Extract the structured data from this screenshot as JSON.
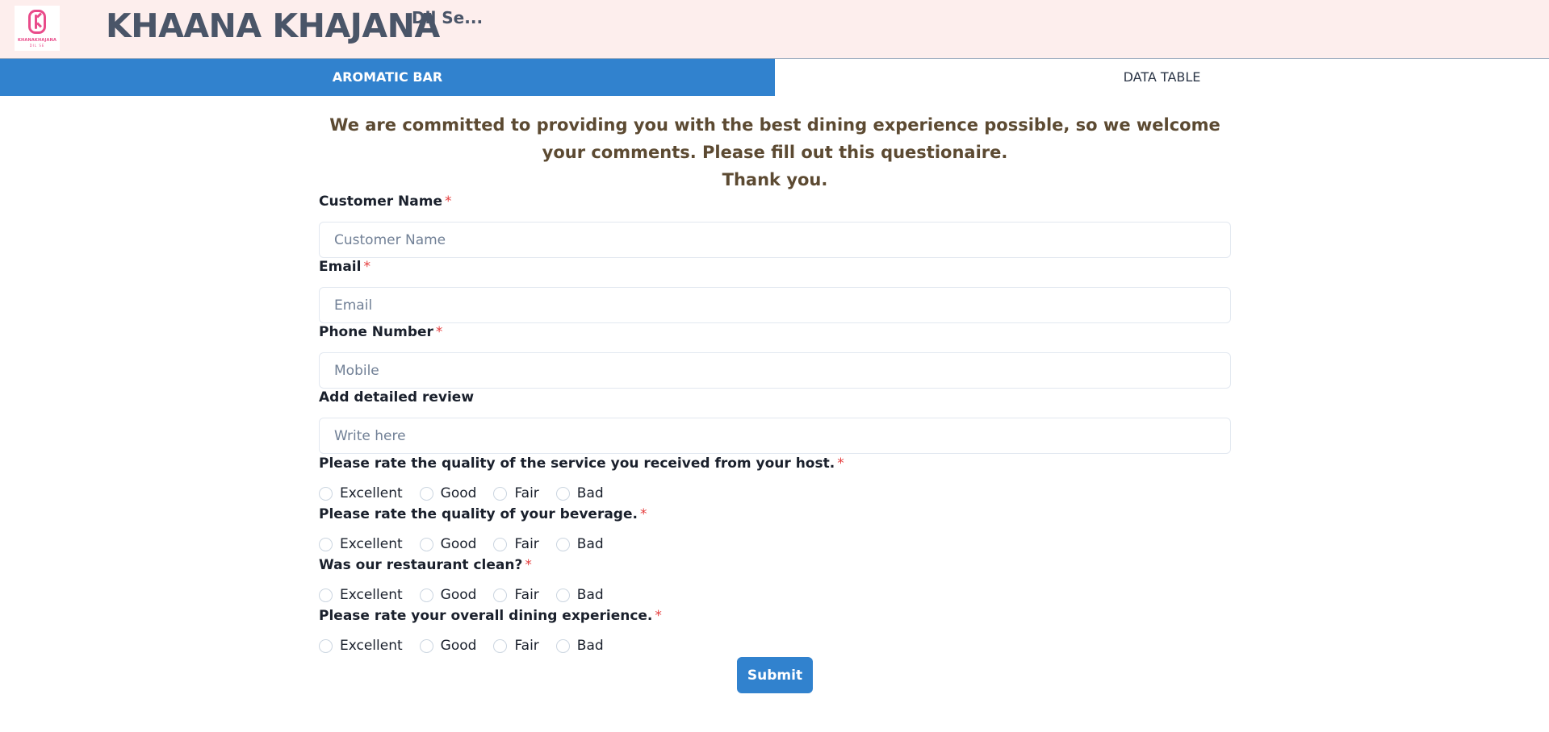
{
  "header": {
    "logo_text": "KHANAKHAJANA",
    "logo_subtext": "DIL SE",
    "brand": "KHAANA KHAJANA",
    "tagline": "Dil Se..."
  },
  "tabs": [
    {
      "label": "AROMATIC BAR",
      "active": true
    },
    {
      "label": "DATA TABLE",
      "active": false
    }
  ],
  "intro": {
    "line1": "We are committed to providing you with the best dining experience possible, so we welcome your comments. Please fill out this questionaire.",
    "line2": "Thank you."
  },
  "form": {
    "required_mark": "*",
    "fields": [
      {
        "label": "Customer Name",
        "placeholder": "Customer Name",
        "value": ""
      },
      {
        "label": "Email",
        "placeholder": "Email",
        "value": ""
      },
      {
        "label": "Phone Number",
        "placeholder": "Mobile",
        "value": ""
      },
      {
        "label": "Add detailed review",
        "placeholder": "Write here",
        "value": ""
      }
    ],
    "rating_options": [
      "Excellent",
      "Good",
      "Fair",
      "Bad"
    ],
    "ratings": [
      {
        "question": "Please rate the quality of the service you received from your host."
      },
      {
        "question": "Please rate the quality of your beverage."
      },
      {
        "question": "Was our restaurant clean?"
      },
      {
        "question": "Please rate your overall dining experience."
      }
    ],
    "submit_label": "Submit"
  },
  "colors": {
    "header_bg": "#fdeeed",
    "accent": "#3182ce",
    "intro_text": "#5c4a32",
    "required": "#e53e3e",
    "logo_pink": "#e94b8a"
  }
}
